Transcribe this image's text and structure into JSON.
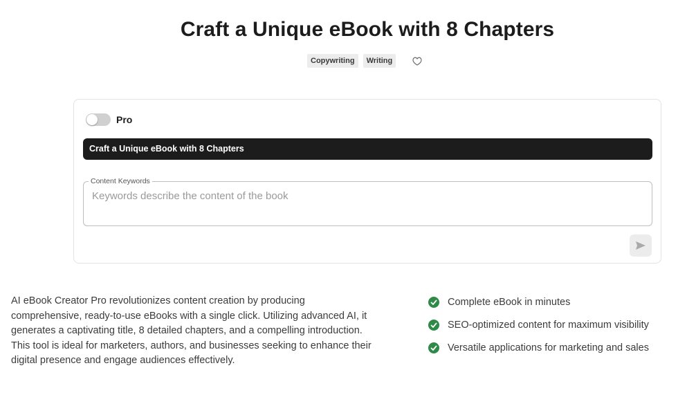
{
  "header": {
    "title": "Craft a Unique eBook with 8 Chapters",
    "tags": [
      "Copywriting",
      "Writing"
    ],
    "favorite_icon": "heart-outline-icon"
  },
  "form": {
    "pro_label": "Pro",
    "pro_enabled": false,
    "prompt_title": "Craft a Unique eBook with 8 Chapters",
    "keywords_label": "Content Keywords",
    "keywords_placeholder": "Keywords describe the content of the book",
    "keywords_value": "",
    "send_icon": "send-icon"
  },
  "description": "AI eBook Creator Pro revolutionizes content creation by producing comprehensive, ready-to-use eBooks with a single click. Utilizing advanced AI, it generates a captivating title, 8 detailed chapters, and a compelling introduction. This tool is ideal for marketers, authors, and businesses seeking to enhance their digital presence and engage audiences effectively.",
  "features": [
    "Complete eBook in minutes",
    "SEO-optimized content for maximum visibility",
    "Versatile applications for marketing and sales"
  ],
  "colors": {
    "check": "#2f8a47",
    "dark_bar": "#1c1c1c",
    "tag_bg": "#ececec"
  }
}
